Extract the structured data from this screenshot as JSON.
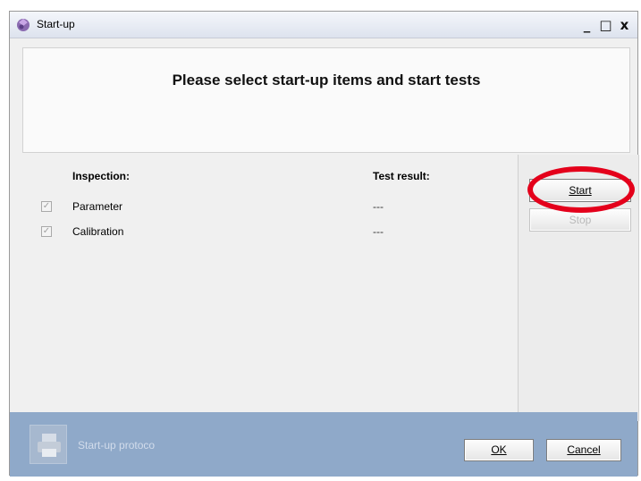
{
  "window": {
    "title": "Start-up",
    "controls": {
      "minimize": "_",
      "maximize": "□",
      "close": "x"
    }
  },
  "header": {
    "title": "Please select start-up items and start tests"
  },
  "list": {
    "col_inspection": "Inspection:",
    "col_result": "Test result:",
    "rows": [
      {
        "label": "Parameter",
        "result": "---",
        "checked": true
      },
      {
        "label": "Calibration",
        "result": "---",
        "checked": true
      }
    ]
  },
  "side_panel": {
    "start_label": "Start",
    "stop_label": "Stop",
    "stop_enabled": false
  },
  "footer": {
    "protocol_label": "Start-up protoco",
    "ok_label": "OK",
    "cancel_label": "Cancel"
  },
  "colors": {
    "footer_bg": "#8fa9c9",
    "highlight_circle": "#e4001b"
  }
}
